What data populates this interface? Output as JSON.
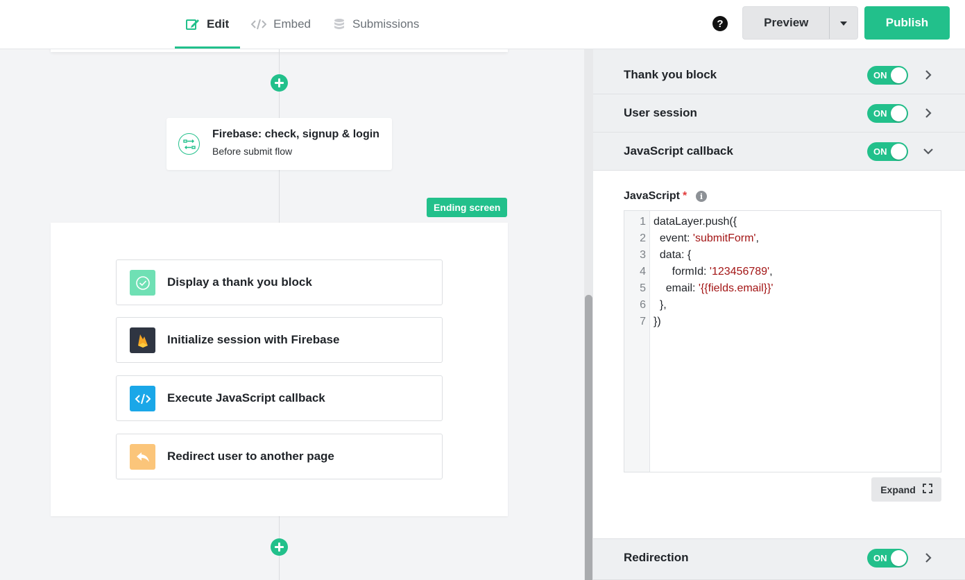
{
  "tabs": [
    {
      "label": "Edit",
      "icon": "edit-icon",
      "active": true
    },
    {
      "label": "Embed",
      "icon": "code-icon",
      "active": false
    },
    {
      "label": "Submissions",
      "icon": "database-icon",
      "active": false
    }
  ],
  "header": {
    "help": "?",
    "preview_label": "Preview",
    "publish_label": "Publish"
  },
  "canvas": {
    "flow_card": {
      "title": "Firebase: check, signup & login",
      "subtitle": "Before submit flow"
    },
    "ending_badge": "Ending screen",
    "actions": [
      {
        "label": "Display a thank you block",
        "icon": "check-circle-icon",
        "color": "#6fe0b4"
      },
      {
        "label": "Initialize session with Firebase",
        "icon": "firebase-icon",
        "color": "#2f3542"
      },
      {
        "label": "Execute JavaScript callback",
        "icon": "code-icon",
        "color": "#1aa7e8"
      },
      {
        "label": "Redirect user to another page",
        "icon": "reply-arrow-icon",
        "color": "#fbc57a"
      }
    ]
  },
  "panel": {
    "sections": [
      {
        "label": "Thank you block",
        "toggle": "ON",
        "expanded": false
      },
      {
        "label": "User session",
        "toggle": "ON",
        "expanded": false
      },
      {
        "label": "JavaScript callback",
        "toggle": "ON",
        "expanded": true
      }
    ],
    "javascript_label": "JavaScript",
    "required_mark": "*",
    "code": {
      "line_numbers": [
        "1",
        "2",
        "3",
        "4",
        "5",
        "6",
        "7"
      ],
      "lines": [
        [
          {
            "t": "dataLayer.push({",
            "s": false
          }
        ],
        [
          {
            "t": "  event: ",
            "s": false
          },
          {
            "t": "'submitForm'",
            "s": true
          },
          {
            "t": ",",
            "s": false
          }
        ],
        [
          {
            "t": "  data: {",
            "s": false
          }
        ],
        [
          {
            "t": "      formId: ",
            "s": false
          },
          {
            "t": "'123456789'",
            "s": true
          },
          {
            "t": ",",
            "s": false
          }
        ],
        [
          {
            "t": "    email: ",
            "s": false
          },
          {
            "t": "'{{fields.email}}'",
            "s": true
          }
        ],
        [
          {
            "t": "  },",
            "s": false
          }
        ],
        [
          {
            "t": "})",
            "s": false
          }
        ]
      ]
    },
    "expand_label": "Expand",
    "redirection": {
      "label": "Redirection",
      "toggle": "ON"
    }
  },
  "colors": {
    "accent": "#22c08b",
    "code_string": "#a31515"
  }
}
